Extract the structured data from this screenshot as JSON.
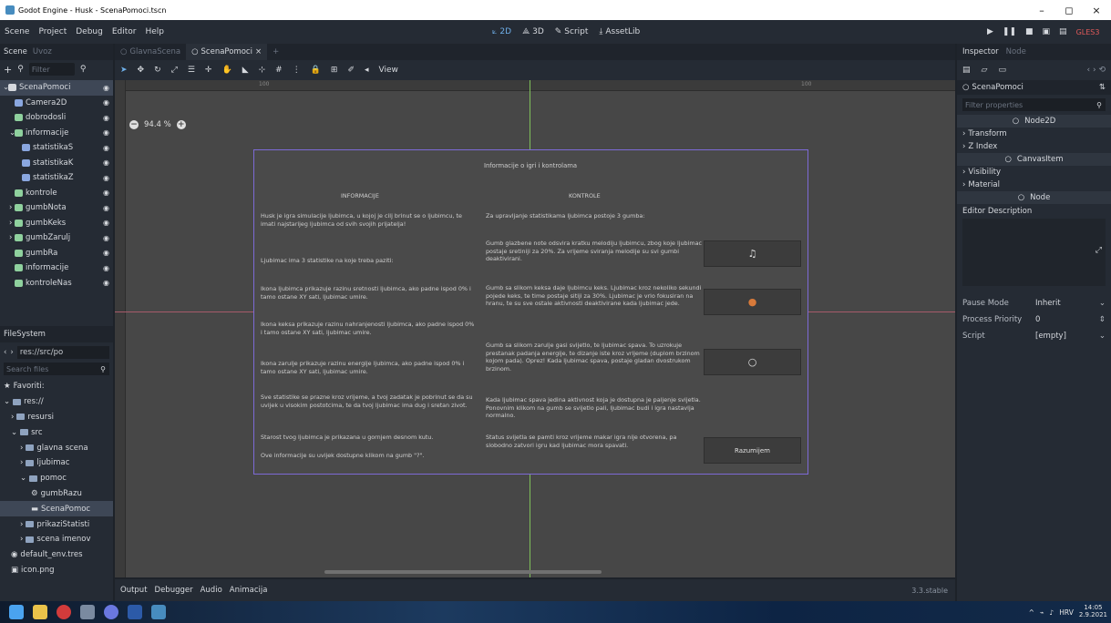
{
  "window": {
    "title": "Godot Engine - Husk - ScenaPomoci.tscn",
    "controls": [
      "–",
      "◻",
      "×"
    ]
  },
  "menu": {
    "items": [
      "Scene",
      "Project",
      "Debug",
      "Editor",
      "Help"
    ],
    "workspaces": [
      {
        "label": "2D",
        "icon": "2d-icon",
        "active": true
      },
      {
        "label": "3D",
        "icon": "3d-icon",
        "active": false
      },
      {
        "label": "Script",
        "icon": "script-icon",
        "active": false
      },
      {
        "label": "AssetLib",
        "icon": "assetlib-icon",
        "active": false
      }
    ],
    "renderer": "GLES3"
  },
  "scene_dock": {
    "tabs": [
      "Scene",
      "Uvoz"
    ],
    "filter_placeholder": "Filter",
    "nodes": [
      {
        "label": "ScenaPomoci",
        "prefix": "⌄",
        "color": "#d6d9de",
        "selected": true
      },
      {
        "label": "Camera2D",
        "prefix": "",
        "color": "#8aa7e0"
      },
      {
        "label": "dobrodosli",
        "prefix": "",
        "color": "#8fd19e"
      },
      {
        "label": "informacije",
        "prefix": "⌄",
        "color": "#8fd19e"
      },
      {
        "label": "statistikaS",
        "prefix": "",
        "color": "#8aa7e0"
      },
      {
        "label": "statistikaK",
        "prefix": "",
        "color": "#8aa7e0"
      },
      {
        "label": "statistikaZ",
        "prefix": "",
        "color": "#8aa7e0"
      },
      {
        "label": "kontrole",
        "prefix": "",
        "color": "#8fd19e"
      },
      {
        "label": "gumbNota",
        "prefix": "›",
        "color": "#8fd19e"
      },
      {
        "label": "gumbKeks",
        "prefix": "›",
        "color": "#8fd19e"
      },
      {
        "label": "gumbZarulj",
        "prefix": "›",
        "color": "#8fd19e"
      },
      {
        "label": "gumbRa",
        "prefix": "",
        "color": "#8fd19e"
      },
      {
        "label": "informacije",
        "prefix": "",
        "color": "#8fd19e"
      },
      {
        "label": "kontroleNas",
        "prefix": "",
        "color": "#8fd19e"
      }
    ]
  },
  "filesystem": {
    "title": "FileSystem",
    "path": "res://src/po",
    "search_placeholder": "Search files",
    "items": [
      {
        "label": "Favoriti:",
        "indent": 4,
        "icon": "★"
      },
      {
        "label": "res://",
        "indent": 4,
        "icon": "folder",
        "prefix": "⌄"
      },
      {
        "label": "resursi",
        "indent": 12,
        "icon": "folder",
        "prefix": "›"
      },
      {
        "label": "src",
        "indent": 12,
        "icon": "folder",
        "prefix": "⌄"
      },
      {
        "label": "glavna scena",
        "indent": 22,
        "icon": "folder",
        "prefix": "›"
      },
      {
        "label": "ljubimac",
        "indent": 22,
        "icon": "folder",
        "prefix": "›"
      },
      {
        "label": "pomoc",
        "indent": 22,
        "icon": "folder",
        "prefix": "⌄"
      },
      {
        "label": "gumbRazu",
        "indent": 34,
        "icon": "⚙"
      },
      {
        "label": "ScenaPomoc",
        "indent": 34,
        "icon": "▬",
        "selected": true
      },
      {
        "label": "prikaziStatisti",
        "indent": 22,
        "icon": "folder",
        "prefix": "›"
      },
      {
        "label": "scena imenov",
        "indent": 22,
        "icon": "folder",
        "prefix": "›"
      },
      {
        "label": "default_env.tres",
        "indent": 12,
        "icon": "◉"
      },
      {
        "label": "icon.png",
        "indent": 12,
        "icon": "▣"
      }
    ]
  },
  "editor": {
    "tabs": [
      {
        "label": "GlavnaScena",
        "active": false
      },
      {
        "label": "ScenaPomoci",
        "active": true
      }
    ],
    "add_tab": "+",
    "view_label": "View",
    "zoom": "94.4 %",
    "ruler_marks": [
      "100",
      "100"
    ],
    "status_version": "3.3.stable"
  },
  "panel": {
    "title": "Informacije o igri i kontrolama",
    "left_header": "INFORMACIJE",
    "right_header": "KONTROLE",
    "left": [
      "Husk je igra simulacije ljubimca, u kojoj je cilj brinut se o ljubimcu, te imati najstarijeg ljubimca od svih svojih prijatelja!",
      "Ljubimac ima 3 statistike na koje treba paziti:",
      "Ikona ljubimca prikazuje razinu sretnosti ljubimca, ako padne ispod 0% i tamo ostane XY sati, ljubimac umire.",
      "Ikona keksa prikazuje razinu nahranjenosti ljubimca, ako padne ispod 0% i tamo ostane XY sati, ljubimac umire.",
      "Ikona zarulje prikazuje razinu energije ljubimca, ako padne ispod 0% i tamo ostane XY sati, ljubimac umire.",
      "Sve statistike se prazne kroz vrijeme, a tvoj zadatak je pobrinut se da su uvijek u visokim postotcima, te da tvoj ljubimac ima dug i sretan zivot.",
      "Starost tvog ljubimca je prikazana u gornjem desnom kutu.",
      "Ove informacije su uvijek dostupne klikom na gumb \"?\"."
    ],
    "right": [
      "Za upravljanje statistikama ljubimca postoje 3 gumba:",
      "Gumb glazbene note odsvira kratku melodiju ljubimcu, zbog koje ljubimac postaje sretiniji za 20%. Za vrijeme sviranja melodije su svi gumbi deaktivirani.",
      "Gumb sa slikom keksa daje ljubimcu keks. Ljubimac kroz nekoliko sekundi pojede keks, te time postaje sitiji za 30%. Ljubimac je vrlo fokusiran na hranu, te su sve ostale aktivnosti deaktivirane kada ljubimac jede.",
      "Gumb sa slikom zarulje gasi svijetlo, te ljubimac spava. To uzrokuje prestanak padanja energije, te dizanje iste kroz vrijeme (duplom brzinom kojom pada). Oprez! Kada ljubimac spava, postaje gladan dvostrukom brzinom.",
      "Kada ljubimac spava jedina aktivnost koja je dostupna je paljenje svijetla. Ponovnim klikom na gumb se svijetlo pali, ljubimac budi i igra nastavlja normalno.",
      "Status svijetla se pamti kroz vrijeme makar igra nije otvorena, pa slobodno zatvori igru kad ljubimac mora spavati."
    ],
    "buttons": [
      {
        "name": "music-note-button",
        "icon": "♫",
        "label": ""
      },
      {
        "name": "cookie-button",
        "icon": "●",
        "label": ""
      },
      {
        "name": "lightbulb-button",
        "icon": "○",
        "label": ""
      },
      {
        "name": "razumijem-button",
        "icon": "",
        "label": "Razumijem"
      }
    ]
  },
  "bottom": {
    "tabs": [
      "Output",
      "Debugger",
      "Audio",
      "Animacija"
    ]
  },
  "inspector": {
    "tabs": [
      "Inspector",
      "Node"
    ],
    "object": "ScenaPomoci",
    "filter_placeholder": "Filter properties",
    "sections": [
      {
        "type": "head",
        "label": "Node2D"
      },
      {
        "type": "sec",
        "label": "Transform"
      },
      {
        "type": "sec",
        "label": "Z Index"
      },
      {
        "type": "head",
        "label": "CanvasItem"
      },
      {
        "type": "sec",
        "label": "Visibility"
      },
      {
        "type": "sec",
        "label": "Material"
      },
      {
        "type": "head",
        "label": "Node"
      }
    ],
    "description_label": "Editor Description",
    "props": [
      {
        "label": "Pause Mode",
        "value": "Inherit",
        "ctrl": "⌄"
      },
      {
        "label": "Process Priority",
        "value": "0",
        "ctrl": "⇕"
      },
      {
        "label": "Script",
        "value": "[empty]",
        "ctrl": "⌄"
      }
    ]
  },
  "taskbar": {
    "lang": "HRV",
    "time": "14:05",
    "date": "2.9.2021"
  }
}
